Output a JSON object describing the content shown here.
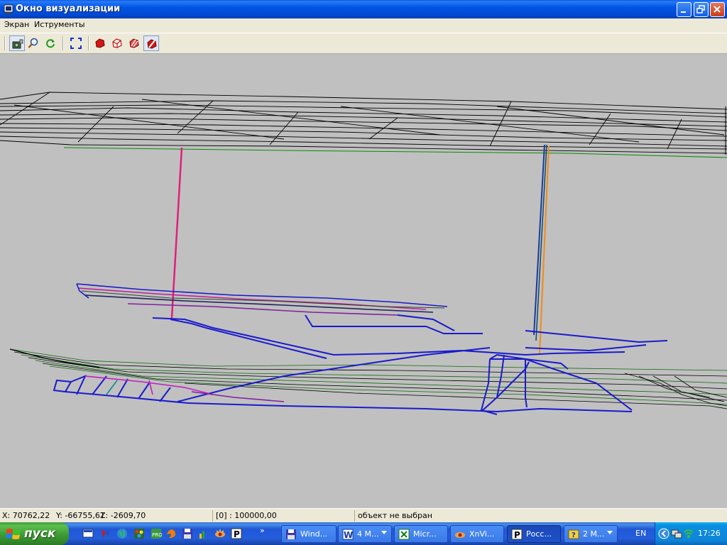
{
  "window": {
    "title": "Окно визуализации",
    "controls": [
      "minimize",
      "maximize",
      "close"
    ]
  },
  "menu": {
    "items": [
      "Экран",
      "Иструменты"
    ]
  },
  "toolbar": {
    "buttons": [
      {
        "name": "camera-icon",
        "pressed": true
      },
      {
        "name": "zoom-icon",
        "pressed": false
      },
      {
        "name": "refresh-icon",
        "pressed": false
      },
      {
        "name": "fit-view-icon",
        "pressed": false
      },
      {
        "name": "solid-shape-icon",
        "pressed": false
      },
      {
        "name": "wireframe-shape-icon",
        "pressed": false
      },
      {
        "name": "hatched-shape-icon",
        "pressed": false
      },
      {
        "name": "section-shape-icon",
        "pressed": true
      }
    ]
  },
  "statusbar": {
    "x": "X: 70762,22",
    "y": "Y: -66755,61",
    "z": "Z: -2609,70",
    "scale": "[0] : 100000,00",
    "selection": "объект не выбран"
  },
  "taskbar": {
    "start_label": "пуск",
    "quick_launch": [
      "desktop-icon",
      "app-icon",
      "globe-icon",
      "paint-icon",
      "firefox-icon",
      "floppy-icon",
      "chart-icon",
      "xnview-icon",
      "p-app-icon"
    ],
    "tasks": [
      {
        "label": "Wind...",
        "icon": "floppy-icon",
        "active": false,
        "group": false
      },
      {
        "label": "4 M...",
        "icon": "word-icon",
        "active": false,
        "group": true
      },
      {
        "label": "Micr...",
        "icon": "excel-icon",
        "active": false,
        "group": false
      },
      {
        "label": "XnVi...",
        "icon": "xnview-icon",
        "active": false,
        "group": false
      },
      {
        "label": "Росс...",
        "icon": "p-app-icon",
        "active": true,
        "group": false
      },
      {
        "label": "2 M...",
        "icon": "help-icon",
        "active": false,
        "group": true
      }
    ],
    "language": "EN",
    "clock": "17:26"
  },
  "colors": {
    "viewport_bg": "#c0c0c0",
    "mesh": "#000000",
    "workings": "#1010c8",
    "shaft_pink": "#e0207a",
    "shaft_orange": "#f08a1a",
    "ground_line": "#0a8a0a",
    "accent_magenta": "#c020c0"
  }
}
